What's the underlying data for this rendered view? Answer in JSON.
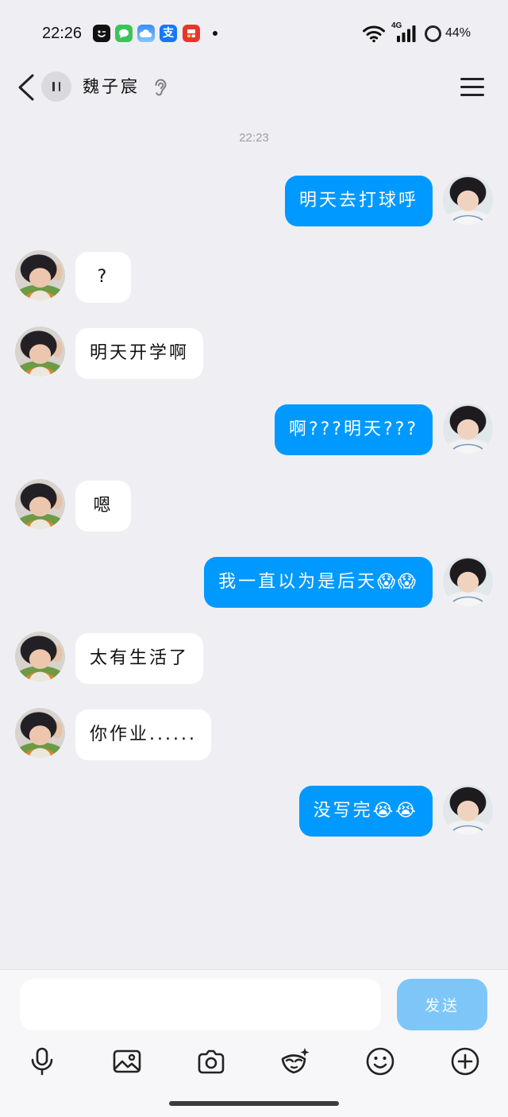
{
  "colors": {
    "background": "#efeff3",
    "panel": "#f7f7f9",
    "sent_bubble": "#0099ff",
    "received_bubble": "#ffffff",
    "send_button": "#7fc6f8"
  },
  "status_bar": {
    "time": "22:26",
    "notification_icons": [
      "app-notification-icon",
      "messages-icon",
      "weather-icon",
      "alipay-icon",
      "shopping-app-icon"
    ],
    "alipay_glyph": "支",
    "network_type": "4G",
    "battery_text": "44%"
  },
  "header": {
    "back_icon": "chevron-left-icon",
    "media_indicator_icon": "pause-icon",
    "contact_name": "魏子宸",
    "mode_icon": "ear-icon",
    "menu_icon": "hamburger-menu-icon"
  },
  "chat": {
    "timestamp": "22:23",
    "messages": [
      {
        "sender": "me",
        "text": "明天去打球呼"
      },
      {
        "sender": "contact",
        "text": "?"
      },
      {
        "sender": "contact",
        "text": "明天开学啊"
      },
      {
        "sender": "me",
        "text": "啊???明天???"
      },
      {
        "sender": "contact",
        "text": "嗯"
      },
      {
        "sender": "me",
        "text": "我一直以为是后天😱😱"
      },
      {
        "sender": "contact",
        "text": "太有生活了"
      },
      {
        "sender": "contact",
        "text": "你作业......"
      },
      {
        "sender": "me",
        "text": "没写完😭😭"
      }
    ]
  },
  "composer": {
    "input_value": "",
    "send_label": "发送",
    "toolbar_icons": [
      "microphone-icon",
      "image-icon",
      "camera-icon",
      "mask-sticker-icon",
      "emoji-icon",
      "plus-circle-icon"
    ]
  }
}
